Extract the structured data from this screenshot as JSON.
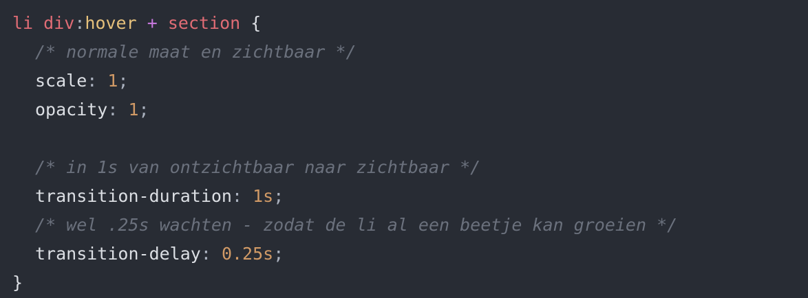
{
  "code": {
    "selector": {
      "li": "li",
      "div": "div",
      "colon": ":",
      "hover": "hover",
      "plus": "+",
      "section": "section",
      "open_brace": "{"
    },
    "comment_1": "/* normale maat en zichtbaar */",
    "scale": {
      "prop": "scale",
      "colon": ": ",
      "value": "1",
      "semi": ";"
    },
    "opacity": {
      "prop": "opacity",
      "colon": ": ",
      "value": "1",
      "semi": ";"
    },
    "comment_2": "/* in 1s van ontzichtbaar naar zichtbaar */",
    "duration": {
      "prop": "transition-duration",
      "colon": ": ",
      "value": "1s",
      "semi": ";"
    },
    "comment_3": "/* wel .25s wachten - zodat de li al een beetje kan groeien */",
    "delay": {
      "prop": "transition-delay",
      "colon": ": ",
      "value": "0.25s",
      "semi": ";"
    },
    "close_brace": "}"
  },
  "colors": {
    "background": "#282c34",
    "selector": "#e06c75",
    "pseudo_class": "#e5c07b",
    "operator": "#c678dd",
    "comment": "#6b717d",
    "number": "#d19a66",
    "text": "#dcdfe4"
  }
}
